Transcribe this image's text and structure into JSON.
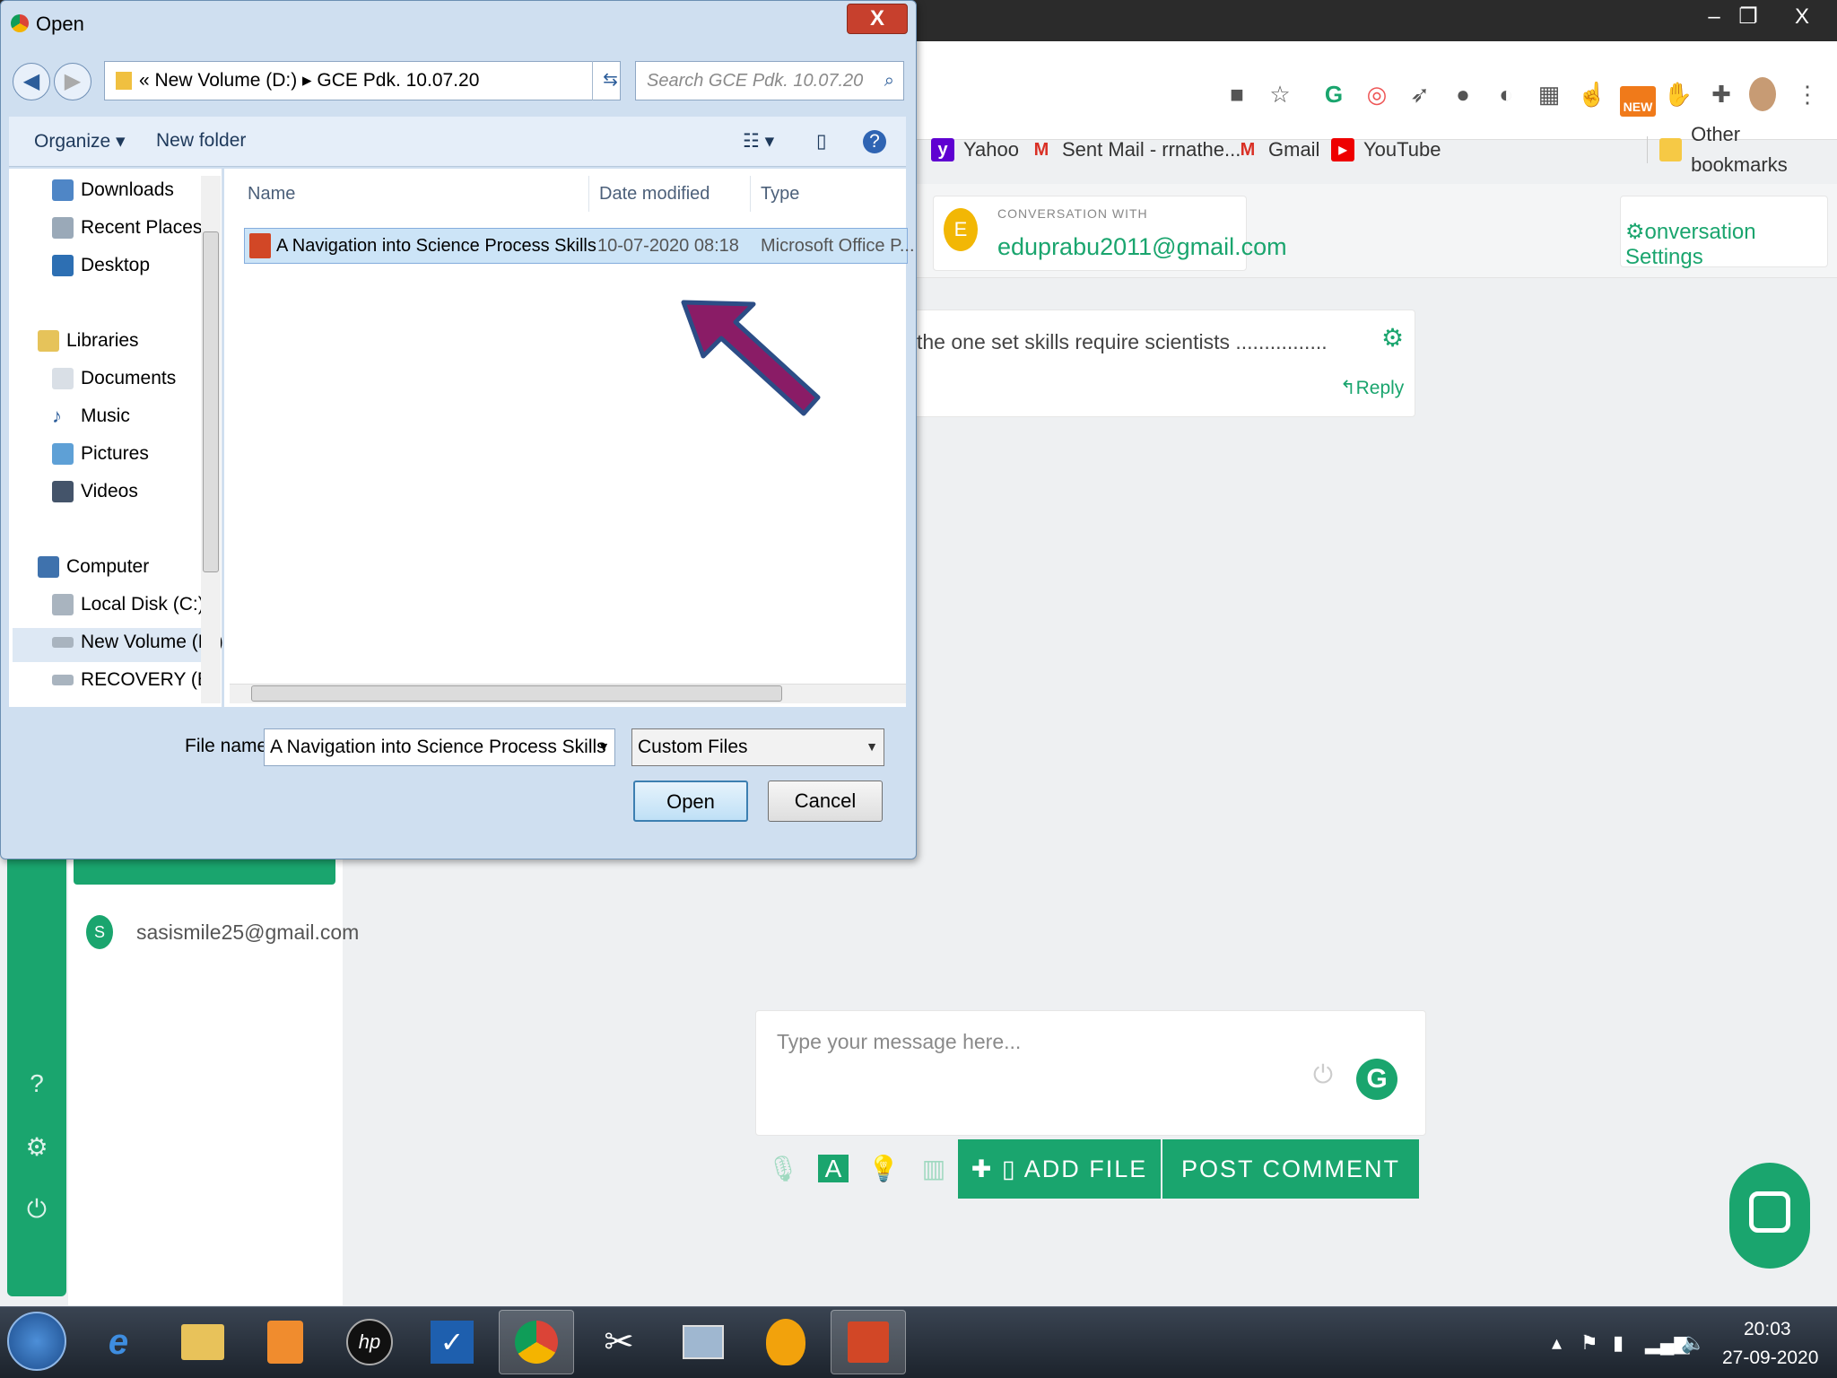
{
  "browser": {
    "bookmarks": [
      "Yahoo",
      "Sent Mail - rrnathe...",
      "Gmail",
      "YouTube",
      "Other bookmarks"
    ],
    "extension_icons": [
      "camera-icon",
      "star-icon",
      "grammarly-icon",
      "extension-icon",
      "rocket-icon",
      "extension-icon",
      "extension-icon",
      "grid-icon",
      "thumb-icon",
      "new-badge-icon",
      "extension-icon",
      "puzzle-icon",
      "profile-icon",
      "menu-icon"
    ],
    "new_badge": "NEW"
  },
  "app": {
    "conversation_label": "CONVERSATION WITH",
    "conversation_email": "eduprabu2011@gmail.com",
    "avatar_letter": "E",
    "settings_label": "onversation Settings",
    "message_text": "the one set skills require scientists ................",
    "reply_label": "Reply",
    "user_letter": "S",
    "user_email": "sasismile25@gmail.com",
    "compose_placeholder": "Type your message here...",
    "tool_a_label": "A",
    "add_file_label": "ADD FILE",
    "post_comment_label": "POST COMMENT",
    "accent_color": "#1aa56e"
  },
  "dialog": {
    "title": "Open",
    "close_label": "X",
    "address_path": "« New Volume (D:) ▸ GCE Pdk. 10.07.20",
    "search_placeholder": "Search GCE Pdk. 10.07.20",
    "organize_label": "Organize ▾",
    "new_folder_label": "New folder",
    "nav_items": [
      "Downloads",
      "Recent Places",
      "Desktop",
      "Libraries",
      "Documents",
      "Music",
      "Pictures",
      "Videos",
      "Computer",
      "Local Disk (C:)",
      "New Volume (D:)",
      "RECOVERY (E:)"
    ],
    "columns": [
      "Name",
      "Date modified",
      "Type"
    ],
    "files": [
      {
        "name": "A Navigation into Science Process Skills",
        "date": "10-07-2020 08:18",
        "type": "Microsoft Office P..."
      }
    ],
    "file_name_label": "File name:",
    "file_name_value": "A Navigation into Science Process Skills",
    "file_type_value": "Custom Files",
    "open_label": "Open",
    "cancel_label": "Cancel"
  },
  "taskbar": {
    "time": "20:03",
    "date": "27-09-2020"
  }
}
